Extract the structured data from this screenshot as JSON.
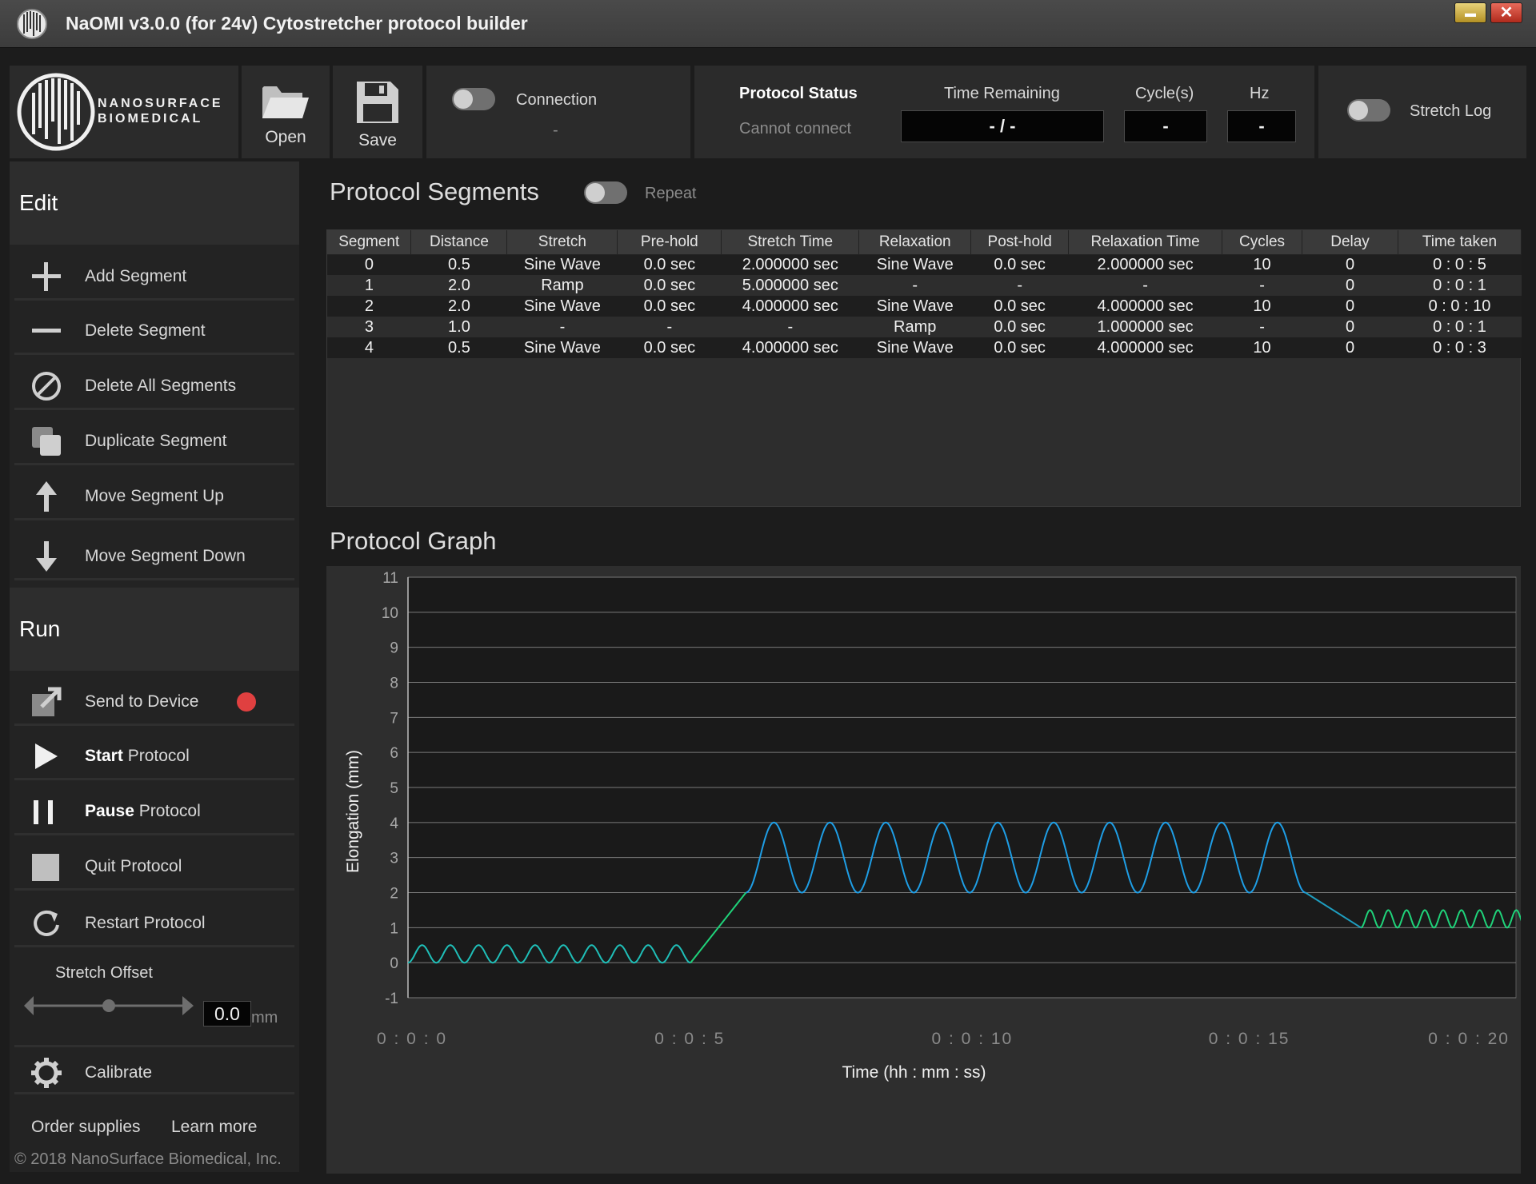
{
  "window": {
    "title": "NaOMI v3.0.0 (for 24v) Cytostretcher protocol builder",
    "minimize_glyph": "▬",
    "close_glyph": "✕"
  },
  "logo": {
    "line1": "NANOSURFACE",
    "line2": "BIOMEDICAL"
  },
  "toolbar": {
    "open_label": "Open",
    "save_label": "Save",
    "connection_label": "Connection",
    "connection_value": "-",
    "protocol_status_label": "Protocol Status",
    "protocol_status_value": "Cannot connect",
    "time_remaining_label": "Time Remaining",
    "time_remaining_value": "- / -",
    "cycles_label": "Cycle(s)",
    "cycles_value": "-",
    "hz_label": "Hz",
    "hz_value": "-",
    "stretch_log_label": "Stretch Log"
  },
  "sidebar": {
    "edit_heading": "Edit",
    "edit_items": [
      {
        "label": "Add Segment",
        "icon": "plus-icon"
      },
      {
        "label": "Delete Segment",
        "icon": "minus-icon"
      },
      {
        "label": "Delete All Segments",
        "icon": "prohibited-icon"
      },
      {
        "label": "Duplicate Segment",
        "icon": "duplicate-icon"
      },
      {
        "label": "Move Segment Up",
        "icon": "arrow-up-icon"
      },
      {
        "label": "Move Segment Down",
        "icon": "arrow-down-icon"
      }
    ],
    "run_heading": "Run",
    "send_label": "Send to Device",
    "send_status_color": "#e04040",
    "start_bold": "Start",
    "start_rest": " Protocol",
    "pause_bold": "Pause",
    "pause_rest": " Protocol",
    "quit_label": "Quit Protocol",
    "restart_label": "Restart Protocol",
    "offset_label": "Stretch Offset",
    "offset_value": "0.0",
    "offset_unit": "mm",
    "calibrate_label": "Calibrate",
    "order_link": "Order supplies",
    "learn_link": "Learn more",
    "copyright": "© 2018 NanoSurface Biomedical, Inc."
  },
  "segments": {
    "heading": "Protocol Segments",
    "repeat_label": "Repeat",
    "columns": [
      "Segment",
      "Distance",
      "Stretch",
      "Pre-hold",
      "Stretch Time",
      "Relaxation",
      "Post-hold",
      "Relaxation Time",
      "Cycles",
      "Delay",
      "Time taken"
    ],
    "rows": [
      [
        "0",
        "0.5",
        "Sine Wave",
        "0.0 sec",
        "2.000000 sec",
        "Sine Wave",
        "0.0 sec",
        "2.000000 sec",
        "10",
        "0",
        "0 : 0 : 5"
      ],
      [
        "1",
        "2.0",
        "Ramp",
        "0.0 sec",
        "5.000000 sec",
        "-",
        "-",
        "-",
        "-",
        "0",
        "0 : 0 : 1"
      ],
      [
        "2",
        "2.0",
        "Sine Wave",
        "0.0 sec",
        "4.000000 sec",
        "Sine Wave",
        "0.0 sec",
        "4.000000 sec",
        "10",
        "0",
        "0 : 0 : 10"
      ],
      [
        "3",
        "1.0",
        "-",
        "-",
        "-",
        "Ramp",
        "0.0 sec",
        "1.000000 sec",
        "-",
        "0",
        "0 : 0 : 1"
      ],
      [
        "4",
        "0.5",
        "Sine Wave",
        "0.0 sec",
        "4.000000 sec",
        "Sine Wave",
        "0.0 sec",
        "4.000000 sec",
        "10",
        "0",
        "0 : 0 : 3"
      ]
    ]
  },
  "graph": {
    "heading": "Protocol Graph"
  },
  "chart_data": {
    "type": "line",
    "xlabel": "Time (hh : mm : ss)",
    "ylabel": "Elongation (mm)",
    "ylim": [
      -1,
      11
    ],
    "xlim": [
      0,
      20
    ],
    "yticks": [
      -1,
      0,
      1,
      2,
      3,
      4,
      5,
      6,
      7,
      8,
      9,
      10,
      11
    ],
    "xticks": [
      {
        "value": 0,
        "label": "0 : 0 : 0"
      },
      {
        "value": 5,
        "label": "0 : 0 : 5"
      },
      {
        "value": 10,
        "label": "0 : 0 : 10"
      },
      {
        "value": 15,
        "label": "0 : 0 : 15"
      },
      {
        "value": 20,
        "label": "0 : 0 : 20"
      }
    ],
    "grid": true,
    "series": [
      {
        "color": "#1fbfb8",
        "kind": "sine",
        "t_start": 0,
        "t_end": 5.1,
        "min": 0,
        "max": 0.5,
        "cycles": 10
      },
      {
        "color": "#1fd37a",
        "kind": "ramp",
        "t_start": 5.1,
        "t_end": 6.1,
        "from": 0,
        "to": 2
      },
      {
        "color": "#1e9ee6",
        "kind": "sine",
        "t_start": 6.1,
        "t_end": 16.2,
        "min": 2,
        "max": 4,
        "cycles": 10
      },
      {
        "color": "#1e9ec0",
        "kind": "ramp",
        "t_start": 16.2,
        "t_end": 17.2,
        "from": 2,
        "to": 1
      },
      {
        "color": "#1fd37a",
        "kind": "sine",
        "t_start": 17.2,
        "t_end": 20.5,
        "min": 1,
        "max": 1.5,
        "cycles": 10
      }
    ],
    "axis_color": "#bdbdbd",
    "plot_bg": "#1a1a1a"
  }
}
